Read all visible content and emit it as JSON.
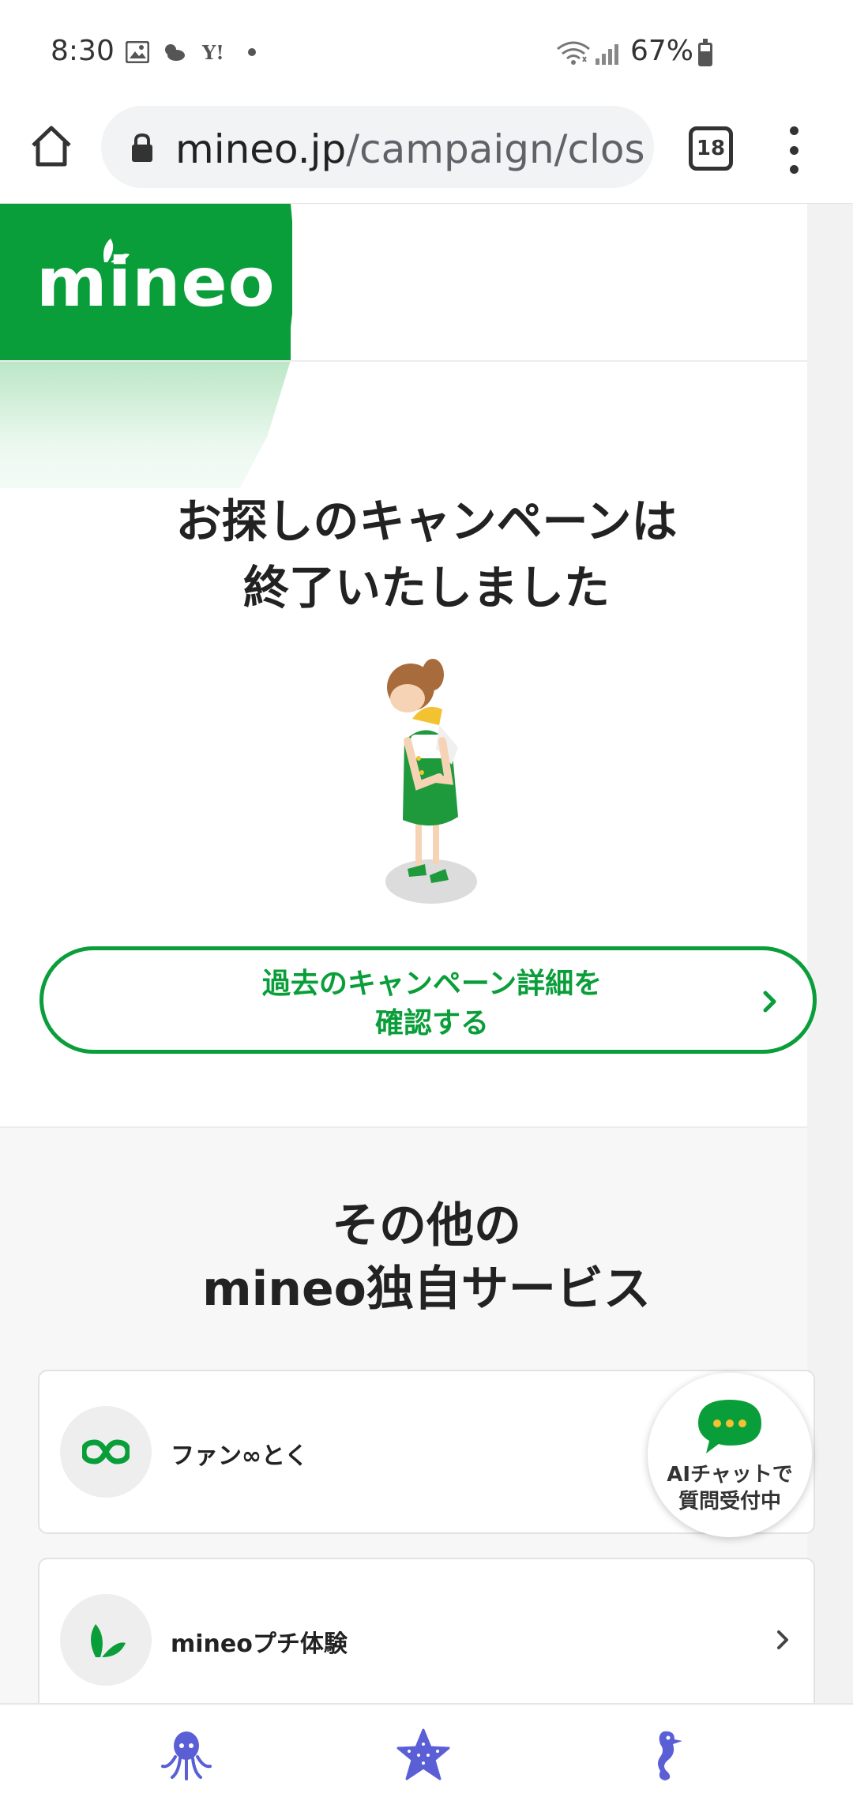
{
  "status_bar": {
    "time": "8:30",
    "battery": "67%",
    "battery_level": 0.67
  },
  "browser": {
    "url_host": "mineo.jp",
    "url_path": "/campaign/clos",
    "tab_count": "18"
  },
  "page": {
    "logo": "mineo",
    "title_line1": "お探しのキャンペーンは",
    "title_line2": "終了いたしました",
    "past_button_line1": "過去のキャンペーン詳細を",
    "past_button_line2": "確認する",
    "section_title_line1": "その他の",
    "section_title_line2": "mineo独自サービス",
    "services": [
      {
        "label": "ファン∞とく",
        "icon": "infinity-icon"
      },
      {
        "label": "mineoプチ体験",
        "icon": "leaf-icon"
      }
    ],
    "ai_chat_line1": "AIチャットで",
    "ai_chat_line2": "質問受付中"
  },
  "colors": {
    "brand_green": "#0a9e3a",
    "icon_purple": "#5b5fd6"
  },
  "bottom_bar": {
    "icons": [
      "octopus-icon",
      "starfish-icon",
      "seahorse-icon"
    ]
  }
}
